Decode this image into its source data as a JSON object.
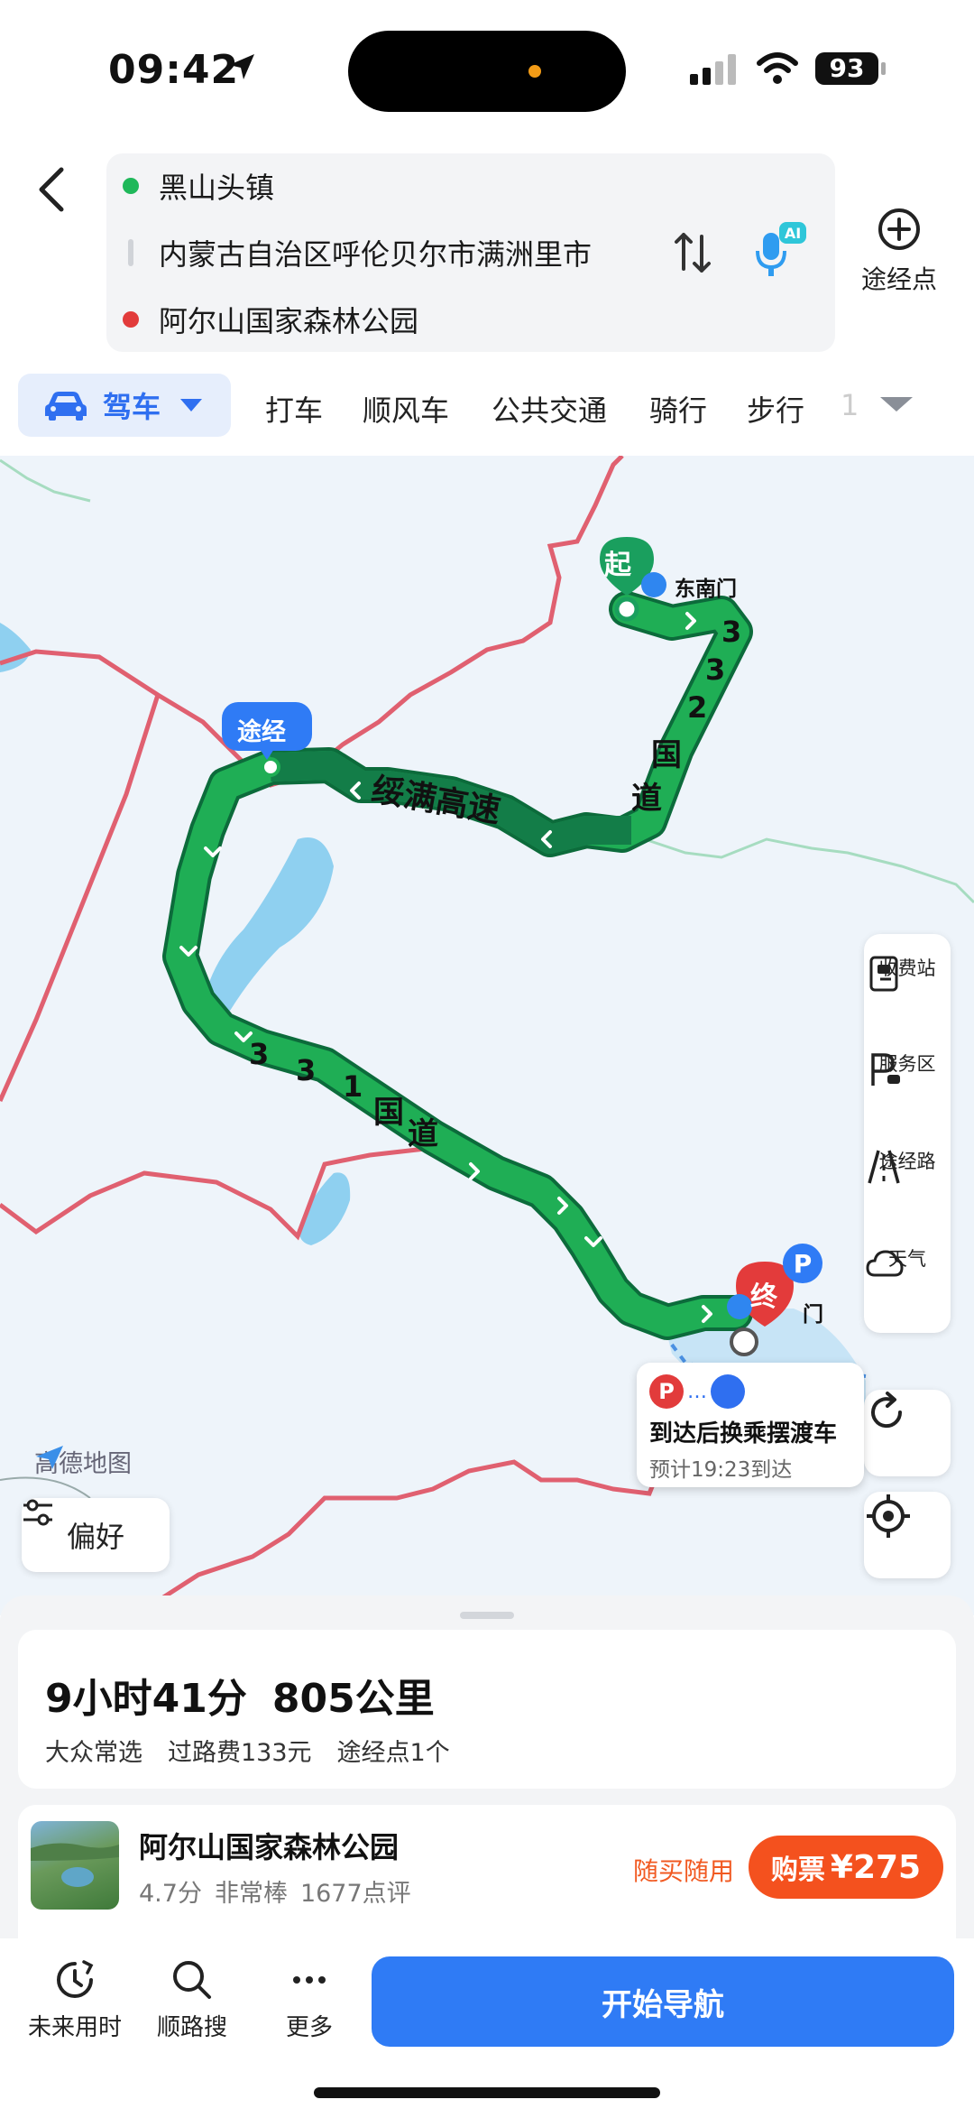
{
  "status_bar": {
    "time": "09:42",
    "battery": "93"
  },
  "route": {
    "origin": "黑山头镇",
    "via": "内蒙古自治区呼伦贝尔市满洲里市",
    "destination": "阿尔山国家森林公园",
    "waypoint_label": "途经点"
  },
  "modes": {
    "active": "驾车",
    "items": [
      "打车",
      "顺风车",
      "公共交通",
      "骑行",
      "步行"
    ],
    "overflow_hint": "1"
  },
  "map": {
    "start_marker": "起",
    "end_marker": "终",
    "via_marker": "途经",
    "poi_gate_1": "东南门",
    "poi_gate_2": "门",
    "road_labels": [
      "绥满高速",
      "3",
      "3",
      "2",
      "国",
      "道",
      "3",
      "3",
      "1",
      "国",
      "道"
    ],
    "tools": [
      "收费站",
      "服务区",
      "途经路",
      "天气"
    ],
    "logo": "高德地图",
    "preference": "偏好",
    "callout": {
      "dots": "…",
      "title": "到达后换乘摆渡车",
      "eta": "预计19:23到达"
    }
  },
  "summary": {
    "duration": "9小时41分",
    "distance": "805公里",
    "meta": [
      "大众常选",
      "过路费133元",
      "途经点1个"
    ]
  },
  "poi": {
    "name": "阿尔山国家森林公园",
    "rating": "4.7分",
    "rating_text": "非常棒",
    "reviews": "1677点评",
    "tag": "随买随用",
    "buy_label": "购票",
    "price": "¥275"
  },
  "bottom_bar": {
    "items": [
      "未来用时",
      "顺路搜",
      "更多"
    ],
    "start": "开始导航"
  },
  "colors": {
    "accent": "#2f7bf5",
    "route": "#1aa84f",
    "route_dark": "#0f7a44",
    "buy": "#f4511e",
    "border": "#e06070"
  }
}
